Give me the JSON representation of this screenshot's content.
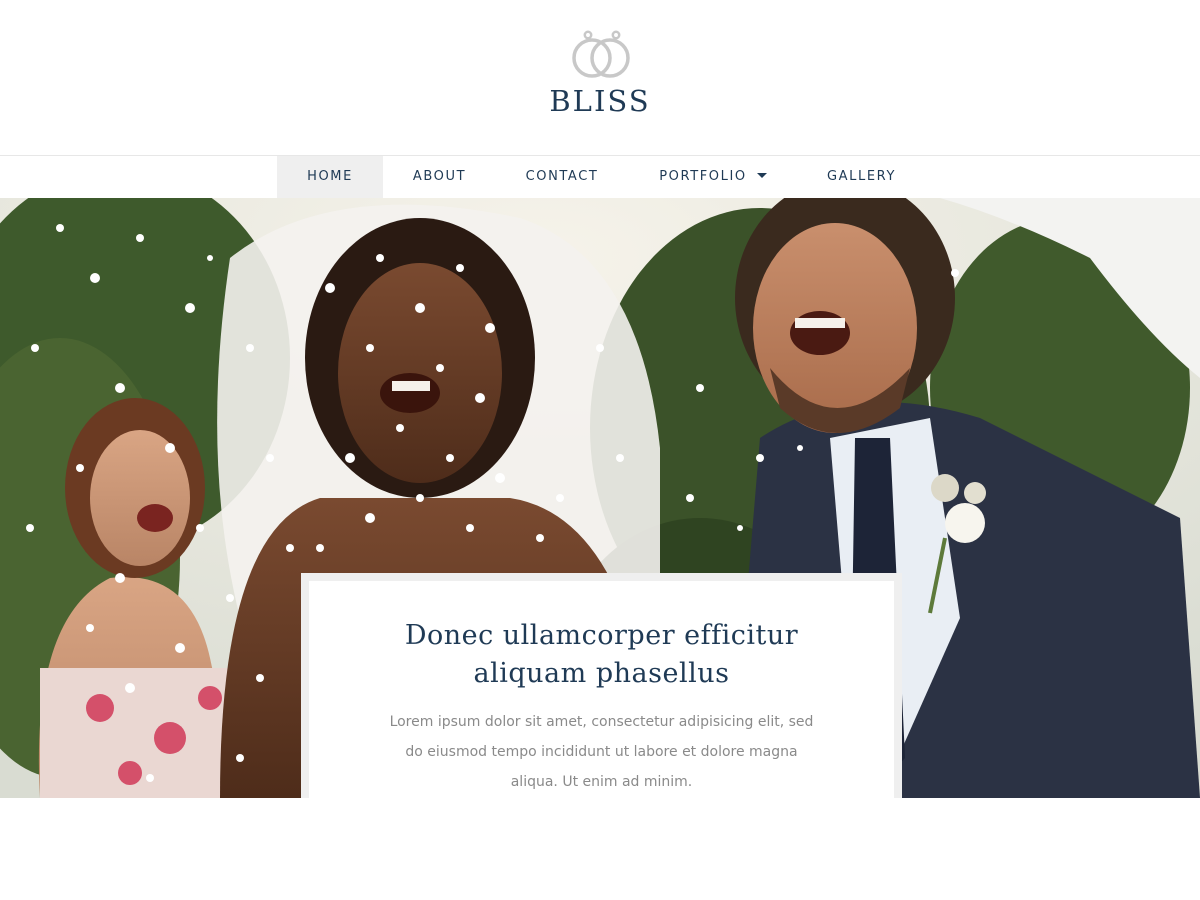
{
  "brand": {
    "logo_icon": "wedding-rings-icon",
    "name": "BLISS"
  },
  "nav": {
    "items": [
      {
        "label": "HOME",
        "active": true
      },
      {
        "label": "ABOUT",
        "active": false
      },
      {
        "label": "CONTACT",
        "active": false
      },
      {
        "label": "PORTFOLIO",
        "active": false,
        "has_dropdown": true
      },
      {
        "label": "GALLERY",
        "active": false
      }
    ]
  },
  "hero": {
    "image": "wedding-couple-confetti-photo",
    "caption_title": "Donec ullamcorper efficitur aliquam phasellus",
    "caption_text": "Lorem ipsum dolor sit amet, consectetur adipisicing elit, sed do eiusmod tempo incididunt ut labore et dolore magna aliqua. Ut enim ad minim."
  },
  "colors": {
    "brand": "#1f3a55",
    "text_muted": "#8a8a8a",
    "nav_active_bg": "#efefef"
  }
}
